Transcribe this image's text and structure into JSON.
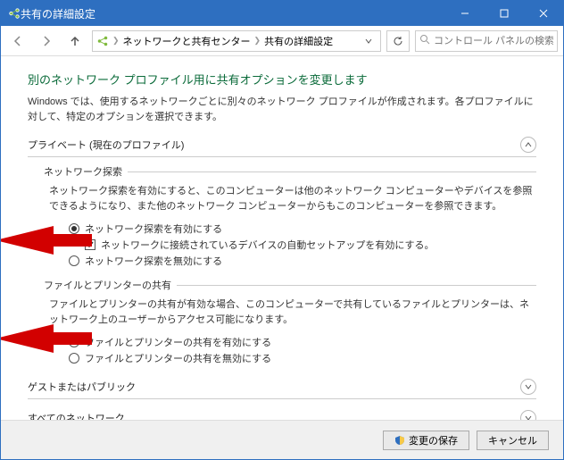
{
  "window": {
    "title": "共有の詳細設定"
  },
  "titlebar": {
    "minimize": "最小化",
    "maximize": "最大化",
    "close": "閉じる"
  },
  "nav": {
    "back": "戻る",
    "forward": "進む",
    "up": "上へ"
  },
  "breadcrumb": {
    "item1": "ネットワークと共有センター",
    "item2": "共有の詳細設定"
  },
  "toolbar": {
    "refresh": "更新"
  },
  "search": {
    "placeholder": "コントロール パネルの検索"
  },
  "main": {
    "heading": "別のネットワーク プロファイル用に共有オプションを変更します",
    "desc": "Windows では、使用するネットワークごとに別々のネットワーク プロファイルが作成されます。各プロファイルに対して、特定のオプションを選択できます。"
  },
  "profiles": {
    "private": {
      "label": "プライベート (現在のプロファイル)",
      "discovery": {
        "title": "ネットワーク探索",
        "desc": "ネットワーク探索を有効にすると、このコンピューターは他のネットワーク コンピューターやデバイスを参照できるようになり、また他のネットワーク コンピューターからもこのコンピューターを参照できます。",
        "enable": "ネットワーク探索を有効にする",
        "auto_setup": "ネットワークに接続されているデバイスの自動セットアップを有効にする。",
        "disable": "ネットワーク探索を無効にする",
        "selected": "enable",
        "auto_setup_checked": true
      },
      "file_share": {
        "title": "ファイルとプリンターの共有",
        "desc": "ファイルとプリンターの共有が有効な場合、このコンピューターで共有しているファイルとプリンターは、ネットワーク上のユーザーからアクセス可能になります。",
        "enable": "ファイルとプリンターの共有を有効にする",
        "disable": "ファイルとプリンターの共有を無効にする",
        "selected": "enable"
      }
    },
    "guest": {
      "label": "ゲストまたはパブリック"
    },
    "all": {
      "label": "すべてのネットワーク"
    }
  },
  "footer": {
    "save": "変更の保存",
    "cancel": "キャンセル"
  }
}
